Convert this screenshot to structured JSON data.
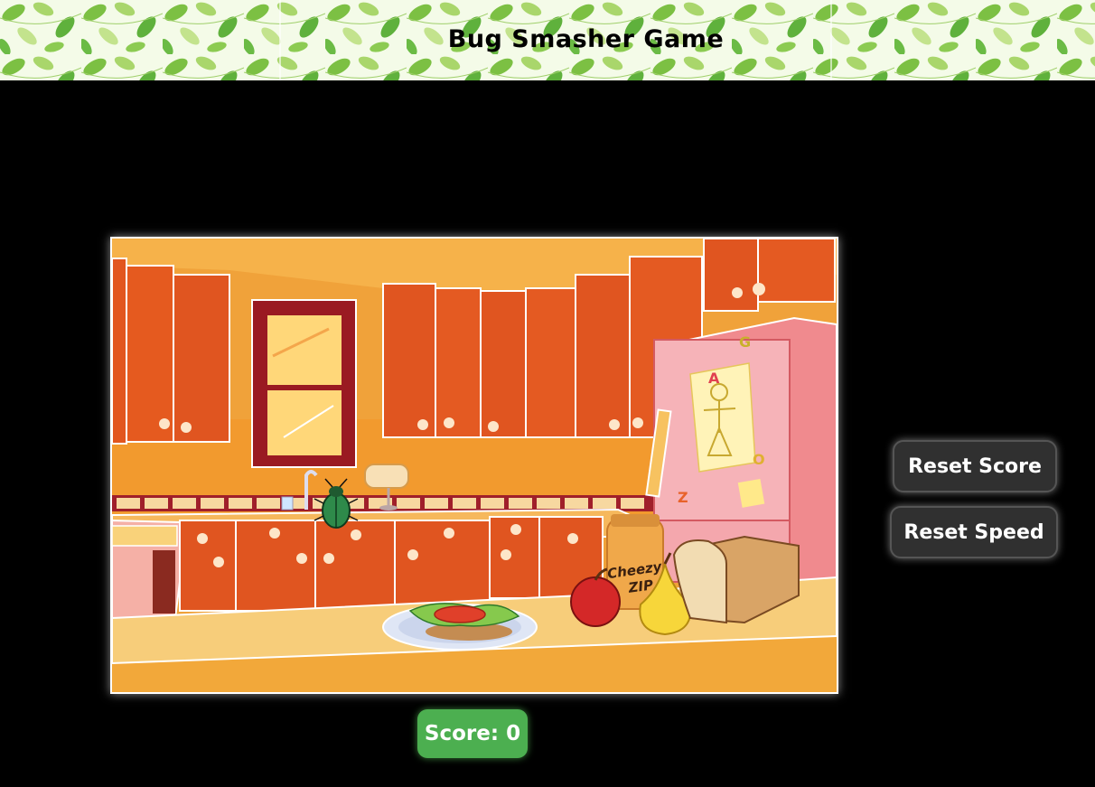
{
  "header": {
    "title": "Bug Smasher Game"
  },
  "game": {
    "jar_label_line1": "Cheezy",
    "jar_label_line2": "ZIP",
    "fridge_magnets": [
      "G",
      "A",
      "O",
      "Z"
    ],
    "bug_icon": "beetle-icon"
  },
  "controls": {
    "reset_score_label": "Reset Score",
    "reset_speed_label": "Reset Speed"
  },
  "score": {
    "label": "Score:",
    "value": 0
  },
  "colors": {
    "background": "#000000",
    "score_bg": "#4caf50",
    "button_bg": "#303030",
    "header_leaf": "#7cc043"
  }
}
